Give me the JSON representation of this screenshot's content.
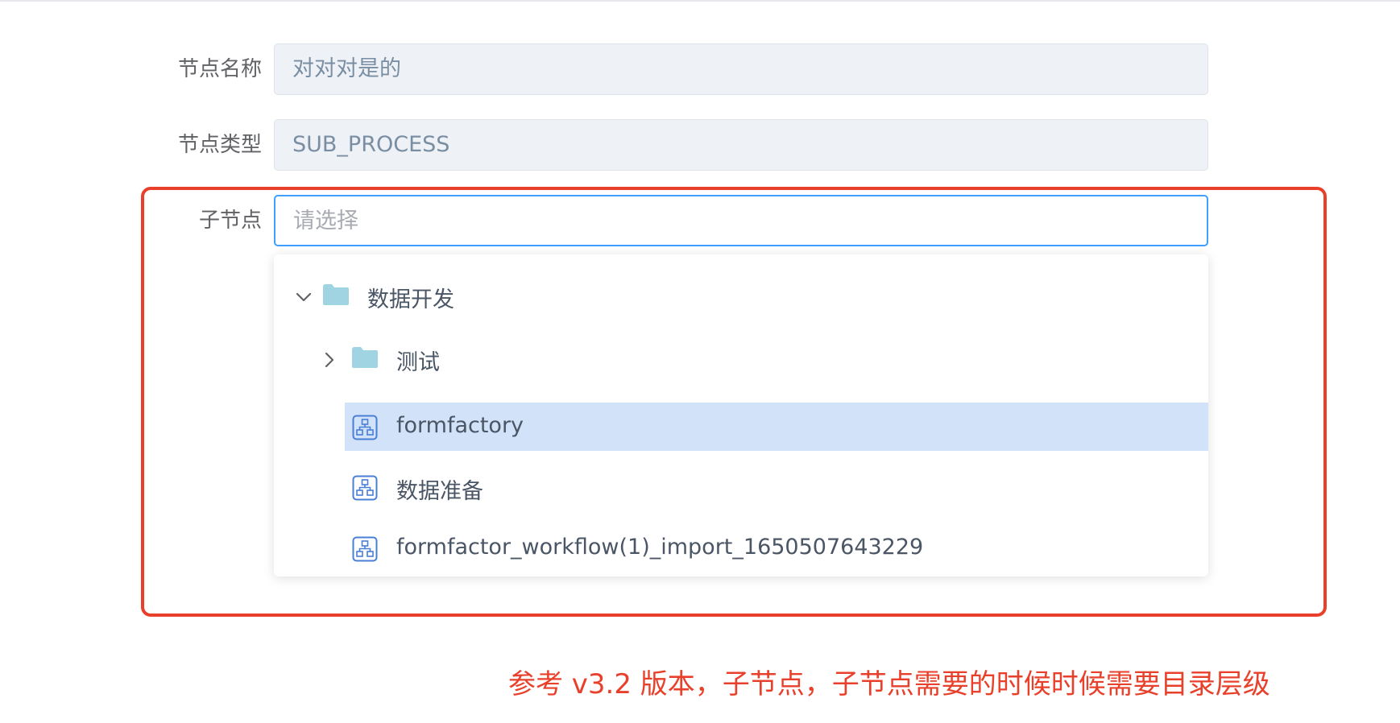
{
  "form": {
    "node_name": {
      "label": "节点名称",
      "value": "对对对是的"
    },
    "node_type": {
      "label": "节点类型",
      "value": "SUB_PROCESS"
    },
    "child_node": {
      "label": "子节点",
      "placeholder": "请选择"
    }
  },
  "tree": {
    "root": {
      "label": "数据开发",
      "icon": "folder-icon",
      "expanded": true
    },
    "items": [
      {
        "label": "测试",
        "icon": "folder-icon",
        "expanded": false
      },
      {
        "label": "formfactory",
        "icon": "workflow-icon",
        "selected": true
      },
      {
        "label": "数据准备",
        "icon": "workflow-icon"
      },
      {
        "label": "formfactor_workflow(1)_import_1650507643229",
        "icon": "workflow-icon"
      }
    ]
  },
  "annotation": {
    "text": "参考 v3.2 版本，子节点，子节点需要的时候时候需要目录层级"
  },
  "colors": {
    "highlight": "#e8402b",
    "focus": "#409eff",
    "selected_row": "#d2e2f8",
    "folder": "#a0d4e3",
    "workflow_icon": "#4a7fd6"
  }
}
